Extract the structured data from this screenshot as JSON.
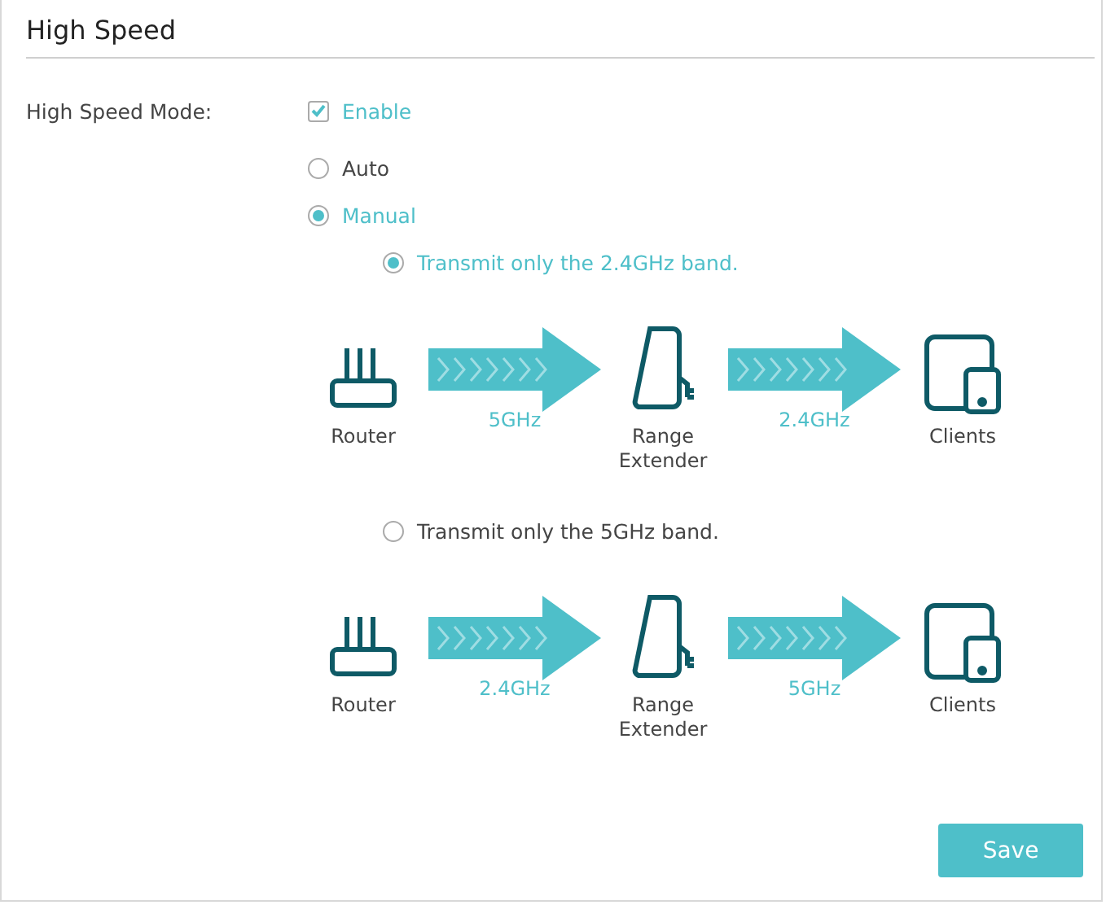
{
  "title": "High Speed",
  "mode": {
    "label": "High Speed Mode:",
    "enable": {
      "label": "Enable",
      "checked": true
    },
    "choices": [
      {
        "label": "Auto",
        "selected": false
      },
      {
        "label": "Manual",
        "selected": true
      }
    ]
  },
  "bands": [
    {
      "label": "Transmit only the 2.4GHz band.",
      "selected": true,
      "diagram": {
        "router": "Router",
        "link_1": "5GHz",
        "extender": "Range Extender",
        "link_2": "2.4GHz",
        "clients": "Clients"
      }
    },
    {
      "label": "Transmit only the 5GHz band.",
      "selected": false,
      "diagram": {
        "router": "Router",
        "link_1": "2.4GHz",
        "extender": "Range Extender",
        "link_2": "5GHz",
        "clients": "Clients"
      }
    }
  ],
  "save": "Save"
}
